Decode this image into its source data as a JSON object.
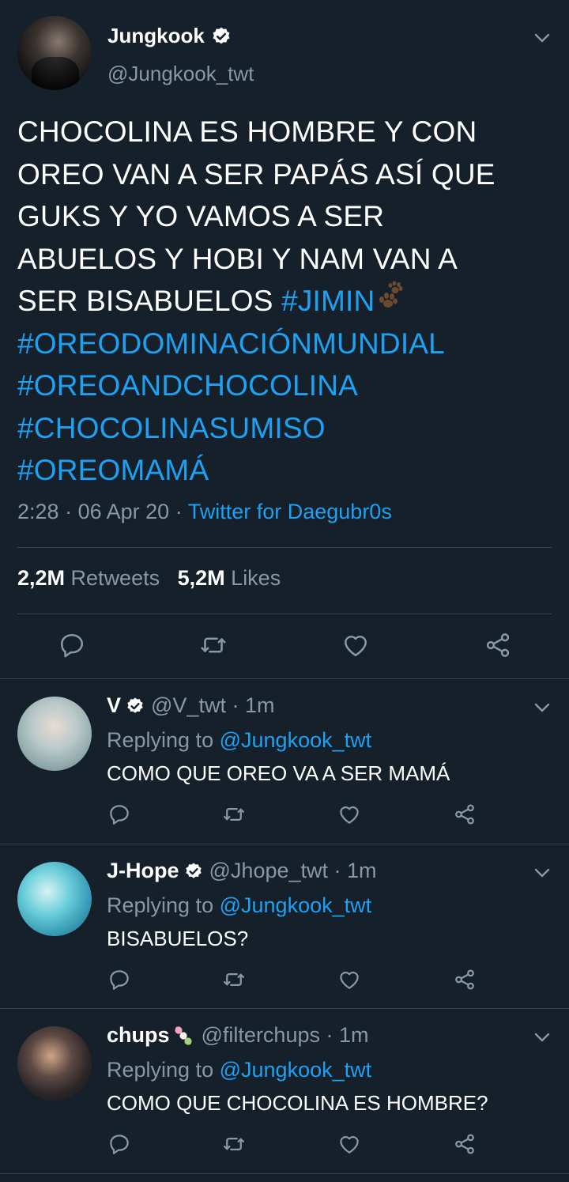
{
  "main_tweet": {
    "display_name": "Jungkook",
    "handle": "@Jungkook_twt",
    "text_plain": "CHOCOLINA ES HOMBRE Y CON OREO VAN A SER PAPÁS ASÍ QUE GUKS Y YO VAMOS A SER ABUELOS Y HOBI Y NAM VAN A SER BISABUELOS",
    "hashtags": [
      "#JIMIN",
      "#OREODOMINACIÓNMUNDIAL",
      "#OREOANDCHOCOLINA",
      "#CHOCOLINASUMISO",
      "#OREOMAMÁ"
    ],
    "time": "2:28",
    "date": "06 Apr 20",
    "separator": "·",
    "source": "Twitter for Daegubr0s",
    "retweets_count": "2,2M",
    "retweets_label": "Retweets",
    "likes_count": "5,2M",
    "likes_label": "Likes"
  },
  "replies": [
    {
      "display_name": "V",
      "verified": true,
      "handle": "@V_twt",
      "time": "1m",
      "replying_label": "Replying to",
      "replying_to": "@Jungkook_twt",
      "text": "COMO QUE OREO VA A SER MAMÁ"
    },
    {
      "display_name": "J-Hope",
      "verified": true,
      "handle": "@Jhope_twt",
      "time": "1m",
      "replying_label": "Replying to",
      "replying_to": "@Jungkook_twt",
      "text": "BISABUELOS?"
    },
    {
      "display_name": "chups",
      "verified": false,
      "handle": "@filterchups",
      "time": "1m",
      "replying_label": "Replying to",
      "replying_to": "@Jungkook_twt",
      "text": "COMO QUE CHOCOLINA ES HOMBRE?"
    }
  ],
  "icons": [
    "chevron-down-icon",
    "verified-badge-icon",
    "paw-prints-icon",
    "dango-icon",
    "reply-icon",
    "retweet-icon",
    "like-icon",
    "share-icon"
  ],
  "colors": {
    "background": "#15202b",
    "link": "#1da1f2",
    "muted": "#8899a6",
    "divider": "#38444d"
  }
}
